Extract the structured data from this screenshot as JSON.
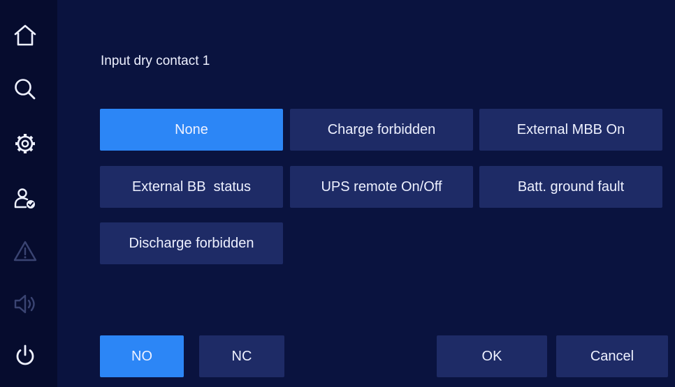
{
  "sidebar": {
    "items": [
      {
        "icon": "home-icon"
      },
      {
        "icon": "search-icon"
      },
      {
        "icon": "gear-icon"
      },
      {
        "icon": "user-settings-icon"
      },
      {
        "icon": "alarm-warning-icon",
        "state": "disabled"
      },
      {
        "icon": "speaker-icon",
        "state": "disabled"
      },
      {
        "icon": "power-icon"
      }
    ]
  },
  "dialog": {
    "title": "Input dry contact 1",
    "options": [
      {
        "label": "None",
        "selected": true
      },
      {
        "label": "Charge forbidden",
        "selected": false
      },
      {
        "label": "External MBB On",
        "selected": false
      },
      {
        "label": "External BB  status",
        "selected": false
      },
      {
        "label": "UPS remote On/Off",
        "selected": false
      },
      {
        "label": "Batt. ground fault",
        "selected": false
      },
      {
        "label": "Discharge forbidden",
        "selected": false
      }
    ],
    "contact_type": {
      "no_label": "NO",
      "nc_label": "NC",
      "selected": "NO"
    },
    "ok_label": "OK",
    "cancel_label": "Cancel"
  },
  "colors": {
    "background": "#0a133f",
    "sidebar": "#060c2e",
    "button": "#1e2b66",
    "accent": "#2c86f6",
    "text": "#eef1ff",
    "disabled_icon": "#3a4472"
  }
}
